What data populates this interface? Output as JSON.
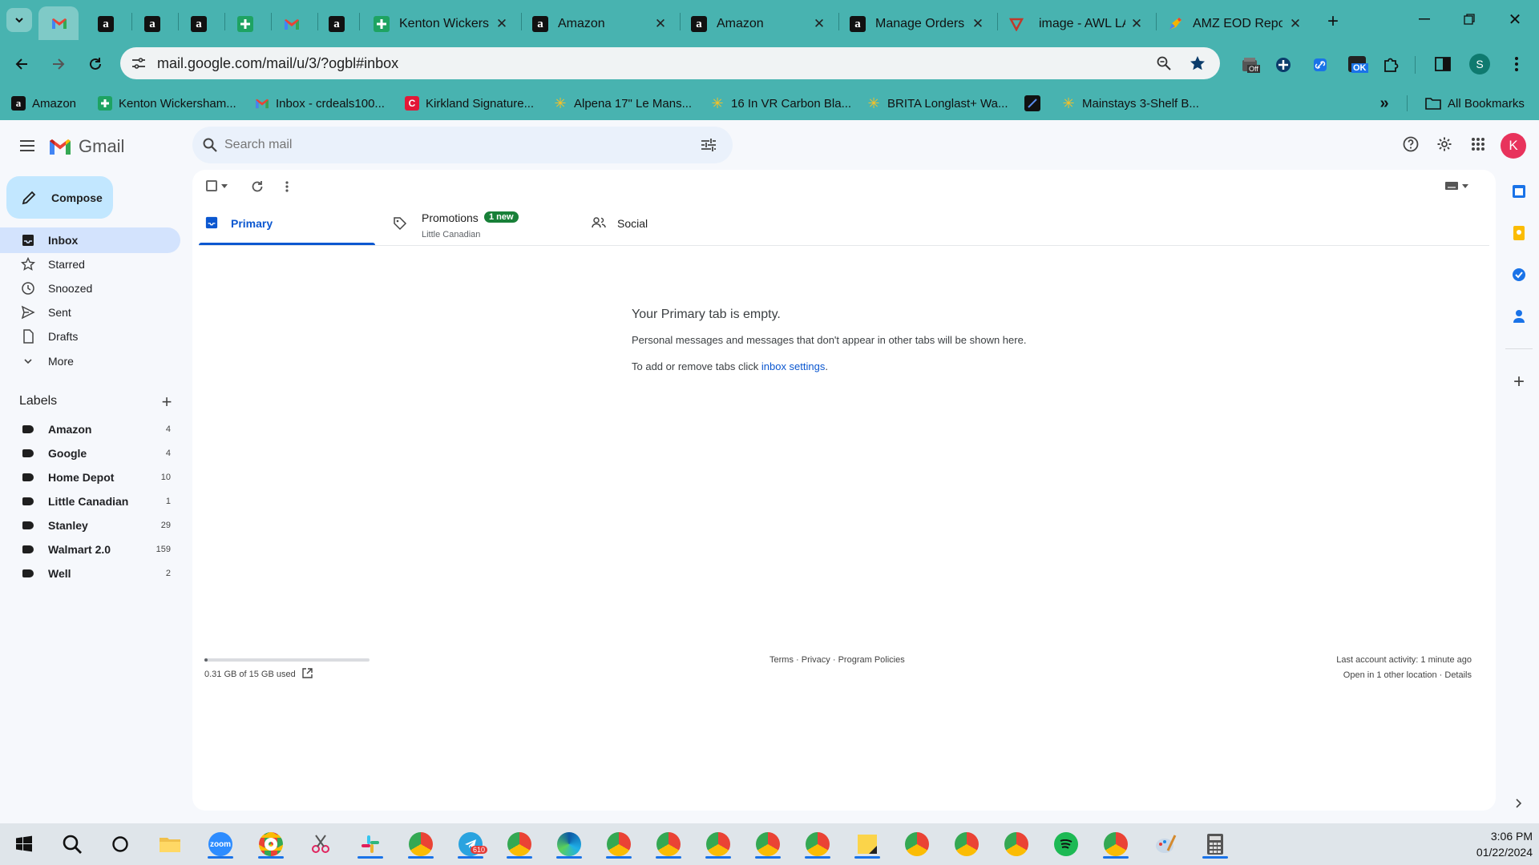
{
  "browser": {
    "tabs": [
      {
        "title": "",
        "icon": "gmail-icon"
      },
      {
        "title": "",
        "icon": "amazon-icon"
      },
      {
        "title": "",
        "icon": "amazon-icon"
      },
      {
        "title": "",
        "icon": "amazon-icon"
      },
      {
        "title": "",
        "icon": "sheets-icon"
      },
      {
        "title": "",
        "icon": "gmail-icon"
      },
      {
        "title": "",
        "icon": "amazon-icon"
      },
      {
        "title": "Kenton Wickersh",
        "icon": "sheets-icon"
      },
      {
        "title": "Amazon",
        "icon": "amazon-icon"
      },
      {
        "title": "Amazon",
        "icon": "amazon-icon"
      },
      {
        "title": "Manage Orders",
        "icon": "amazon-icon"
      },
      {
        "title": "image - AWL LA",
        "icon": "awl-icon"
      },
      {
        "title": "AMZ EOD Repor",
        "icon": "pen-icon"
      }
    ],
    "url": "mail.google.com/mail/u/3/?ogbl#inbox",
    "profile_initial": "S",
    "extension_badges": {
      "off": "Off",
      "ok": "OK"
    },
    "bookmarks": [
      {
        "label": "Amazon",
        "icon": "amazon-icon"
      },
      {
        "label": "Kenton Wickersham...",
        "icon": "sheets-icon"
      },
      {
        "label": "Inbox - crdeals100...",
        "icon": "gmail-icon"
      },
      {
        "label": "Kirkland Signature...",
        "icon": "costco-icon"
      },
      {
        "label": "Alpena 17\" Le Mans...",
        "icon": "walmart-icon"
      },
      {
        "label": "16 In VR Carbon Bla...",
        "icon": "walmart-icon"
      },
      {
        "label": "BRITA Longlast+ Wa...",
        "icon": "walmart-icon"
      },
      {
        "label": "",
        "icon": "app-icon"
      },
      {
        "label": "Mainstays 3-Shelf B...",
        "icon": "walmart-icon"
      }
    ],
    "all_bookmarks": "All Bookmarks"
  },
  "gmail": {
    "brand": "Gmail",
    "search_placeholder": "Search mail",
    "compose": "Compose",
    "account_initial": "K",
    "nav": [
      {
        "label": "Inbox",
        "icon": "inbox-icon",
        "active": true
      },
      {
        "label": "Starred",
        "icon": "star-icon"
      },
      {
        "label": "Snoozed",
        "icon": "clock-icon"
      },
      {
        "label": "Sent",
        "icon": "send-icon"
      },
      {
        "label": "Drafts",
        "icon": "draft-icon"
      },
      {
        "label": "More",
        "icon": "chevron-down-icon"
      }
    ],
    "labels_title": "Labels",
    "labels": [
      {
        "name": "Amazon",
        "count": "4"
      },
      {
        "name": "Google",
        "count": "4"
      },
      {
        "name": "Home Depot",
        "count": "10"
      },
      {
        "name": "Little Canadian",
        "count": "1"
      },
      {
        "name": "Stanley",
        "count": "29"
      },
      {
        "name": "Walmart 2.0",
        "count": "159"
      },
      {
        "name": "Well",
        "count": "2"
      }
    ],
    "tabs": {
      "primary": "Primary",
      "promotions": "Promotions",
      "promotions_badge": "1 new",
      "promotions_sub": "Little Canadian",
      "social": "Social"
    },
    "empty": {
      "title": "Your Primary tab is empty.",
      "line1": "Personal messages and messages that don't appear in other tabs will be shown here.",
      "line2_prefix": "To add or remove tabs click ",
      "line2_link": "inbox settings",
      "line2_suffix": "."
    },
    "storage": {
      "text": "0.31 GB of 15 GB used",
      "fraction": 0.02
    },
    "footer": {
      "terms": "Terms",
      "privacy": "Privacy",
      "policies": "Program Policies",
      "sep": " · "
    },
    "activity": {
      "line1": "Last account activity: 1 minute ago",
      "line2": "Open in 1 other location",
      "details": "Details"
    }
  },
  "taskbar": {
    "time": "3:06 PM",
    "date": "01/22/2024",
    "telegram_badge": "610",
    "zoom_label": "zoom"
  },
  "colors": {
    "browser_chrome": "#48b3b0",
    "accent": "#0b57d0",
    "compose_bg": "#c2e7ff",
    "active_nav": "#d3e3fd"
  }
}
